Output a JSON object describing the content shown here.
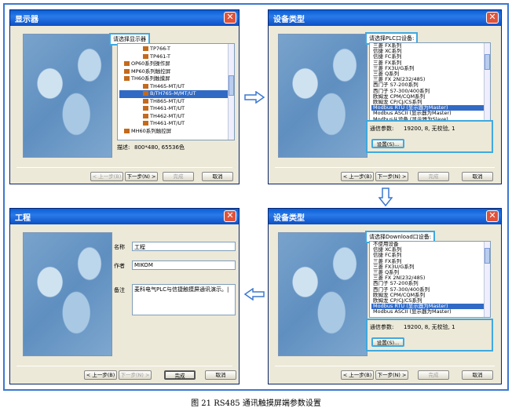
{
  "figure_caption": "图 21   RS485 通讯触摸屏端参数设置",
  "win1": {
    "title": "显示器",
    "prompt": "请选择显示器",
    "tree": [
      "TP766-T",
      "TP461-T",
      "OP60系列操作屏",
      "MP60系列触控屏",
      "TH60系列触摸屏",
      "TH465-MT/UT",
      "B/TH765-M/MT/UT",
      "TH865-MT/UT",
      "TH461-MT/UT",
      "TH462-MT/UT",
      "TH461-MT/UT",
      "MH60系列触控屏"
    ],
    "selected_index": 6,
    "desc_label": "描述:",
    "desc_value": "800*480, 65536色",
    "buttons": {
      "back": "< 上一步(B)",
      "next": "下一步(N) >",
      "finish": "完成",
      "cancel": "取消"
    }
  },
  "win2": {
    "title": "设备类型",
    "prompt": "请选择PLC口设备:",
    "devices": [
      "三菱 FX系列",
      "信捷 XC系列",
      "信捷 FC系列",
      "三菱 FX系列",
      "三菱 FX3U/G系列",
      "三菱 Q系列",
      "三菱 FX 2N(232/485)",
      "西门子 S7-200系列",
      "西门子 S7-300/400系列",
      "欧姆龙 CPM/CQM系列",
      "欧姆龙 CP/CJ/CS系列",
      "Modbus RTU (显示器为Master)",
      "Modbus ASCII (显示器为Master)",
      "Modbus从设备 (显示器为Slave)"
    ],
    "selected_index": 11,
    "comm_label": "通信参数:",
    "comm_value": "19200, 8, 无校验, 1",
    "settings_btn": "设置(S)...",
    "buttons": {
      "back": "< 上一步(B)",
      "next": "下一步(N) >",
      "finish": "完成",
      "cancel": "取消"
    }
  },
  "win3": {
    "title": "工程",
    "name_label": "名称",
    "name_value": "工程",
    "author_label": "作者",
    "author_value": "MIKOM",
    "note_label": "备注",
    "note_value": "麦科电气PLC与信捷触摸屏通讯演示。|",
    "buttons": {
      "back": "< 上一步(B)",
      "next": "下一步(N) >",
      "finish": "完成",
      "cancel": "取消"
    }
  },
  "win4": {
    "title": "设备类型",
    "prompt": "请选择Download口设备:",
    "devices": [
      "不使用设备",
      "信捷 XC系列",
      "信捷 FC系列",
      "三菱 FX系列",
      "三菱 FX3U/G系列",
      "三菱 Q系列",
      "三菱 FX 2N(232/485)",
      "西门子 S7-200系列",
      "西门子 S7-300/400系列",
      "欧姆龙 CPM/CQM系列",
      "欧姆龙 CP/CJ/CS系列",
      "Modbus RTU (显示器为Master)",
      "Modbus ASCII (显示器为Master)"
    ],
    "selected_index": 11,
    "comm_label": "通信参数:",
    "comm_value": "19200, 8, 无校验, 1",
    "settings_btn": "设置(S)...",
    "buttons": {
      "back": "< 上一步(B)",
      "next": "下一步(N) >",
      "finish": "完成",
      "cancel": "取消"
    }
  },
  "colors": {
    "titlebar": "#0a5fd7",
    "highlight_border": "#3fa9e0",
    "outer_border": "#3b78d0"
  }
}
